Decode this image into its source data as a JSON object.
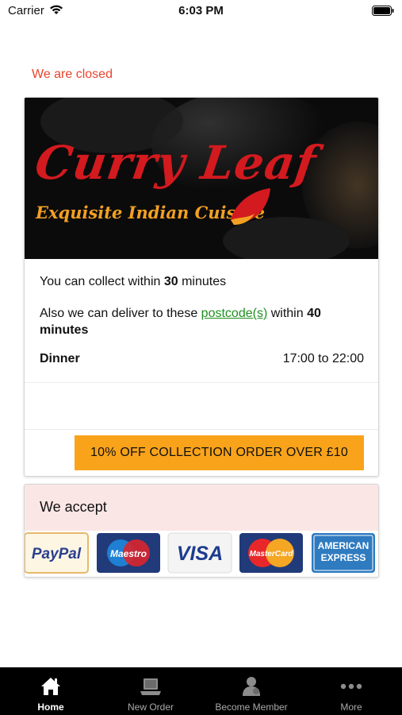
{
  "status_bar": {
    "carrier": "Carrier",
    "time": "6:03 PM"
  },
  "notice": {
    "closed": "We are closed"
  },
  "restaurant": {
    "name": "Curry Leaf",
    "tagline": "Exquisite Indian Cuisine",
    "brand_colors": {
      "name": "#d31a1f",
      "tagline": "#f2a022"
    }
  },
  "info": {
    "collect_prefix": "You can collect within ",
    "collect_minutes": "30",
    "collect_suffix": " minutes",
    "deliver_prefix": "Also we can deliver to these ",
    "postcode_link": "postcode(s)",
    "deliver_middle": " within ",
    "deliver_minutes": "40",
    "deliver_suffix": "minutes",
    "hours": {
      "label": "Dinner",
      "value": "17:00 to 22:00"
    }
  },
  "offer": {
    "label": "10% OFF COLLECTION ORDER OVER £10",
    "color": "#f9a31b"
  },
  "accept": {
    "title": "We accept",
    "methods": [
      "PayPal",
      "Maestro",
      "VISA",
      "MasterCard",
      "AMERICAN EXPRESS"
    ]
  },
  "tabs": [
    {
      "label": "Home",
      "icon": "home-icon",
      "active": true
    },
    {
      "label": "New Order",
      "icon": "laptop-icon",
      "active": false
    },
    {
      "label": "Become Member",
      "icon": "user-icon",
      "active": false
    },
    {
      "label": "More",
      "icon": "more-dots-icon",
      "active": false
    }
  ],
  "colors": {
    "closed_text": "#e8432e",
    "link": "#1f8f1f",
    "accept_header_bg": "#fbe6e6"
  }
}
